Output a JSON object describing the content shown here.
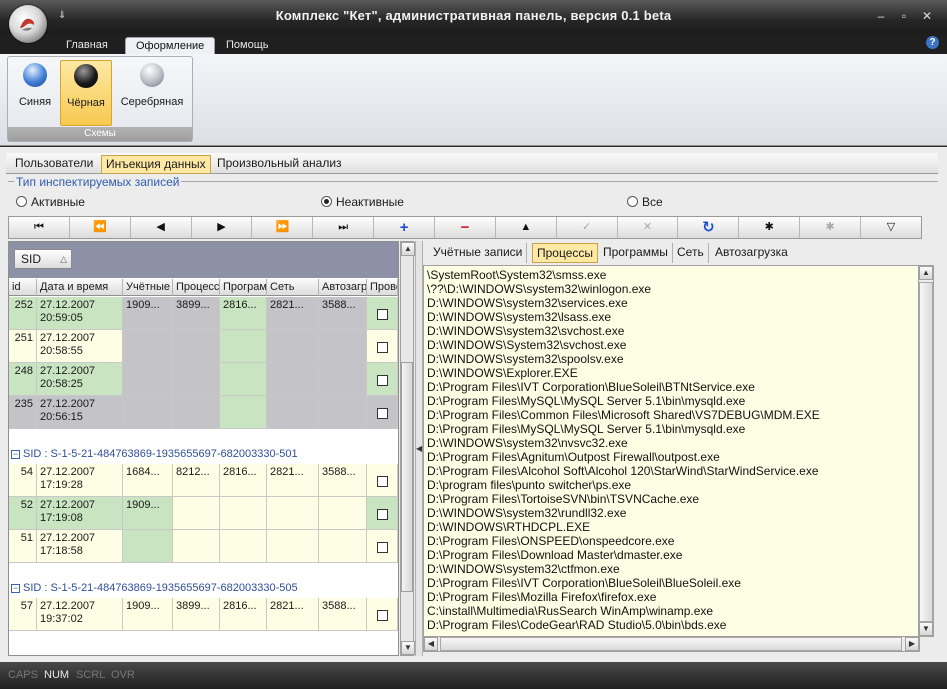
{
  "window": {
    "title": "Комплекс \"Кет\", административная панель, версия 0.1 beta",
    "qat_glyph": "⇓",
    "buttons": {
      "minimize": "–",
      "maximize": "▫",
      "close": "✕"
    }
  },
  "ribbon": {
    "tabs": [
      "Главная",
      "Оформление",
      "Помощь"
    ],
    "active_tab": "Оформление",
    "help_glyph": "?",
    "group_caption": "Схемы",
    "schemes": [
      {
        "label": "Синяя",
        "color": "#3f7fd6",
        "selected": false
      },
      {
        "label": "Чёрная",
        "color": "#111111",
        "selected": true
      },
      {
        "label": "Серебряная",
        "color": "#b9bcc4",
        "selected": false
      }
    ]
  },
  "main_tabs": [
    "Пользователи",
    "Инъекция данных",
    "Произвольный анализ"
  ],
  "active_main_tab": "Инъекция данных",
  "filter": {
    "legend": "Тип инспектируемых записей",
    "options": [
      {
        "label": "Активные",
        "checked": false
      },
      {
        "label": "Неактивные",
        "checked": true
      },
      {
        "label": "Все",
        "checked": false
      }
    ]
  },
  "navigator": [
    {
      "icon": "first-record-icon",
      "glyph": "⏮",
      "style": ""
    },
    {
      "icon": "prior-page-icon",
      "glyph": "⏪",
      "style": ""
    },
    {
      "icon": "prior-record-icon",
      "glyph": "◀",
      "style": ""
    },
    {
      "icon": "next-record-icon",
      "glyph": "▶",
      "style": ""
    },
    {
      "icon": "next-page-icon",
      "glyph": "⏩",
      "style": ""
    },
    {
      "icon": "last-record-icon",
      "glyph": "⏭",
      "style": ""
    },
    {
      "icon": "insert-icon",
      "glyph": "+",
      "style": "blue"
    },
    {
      "icon": "delete-icon",
      "glyph": "−",
      "style": "red"
    },
    {
      "icon": "edit-icon",
      "glyph": "▲",
      "style": ""
    },
    {
      "icon": "post-icon",
      "glyph": "✓",
      "style": "dis"
    },
    {
      "icon": "cancel-icon",
      "glyph": "✕",
      "style": "dis"
    },
    {
      "icon": "refresh-icon",
      "glyph": "↻",
      "style": "blue"
    },
    {
      "icon": "bookmark-icon",
      "glyph": "✱",
      "style": ""
    },
    {
      "icon": "goto-bookmark-icon",
      "glyph": "✱",
      "style": "dis"
    },
    {
      "icon": "filter-icon",
      "glyph": "▽",
      "style": ""
    }
  ],
  "grid": {
    "group_by_chip": "SID",
    "group_by_sort_glyph": "△",
    "columns": [
      "id",
      "Дата и время",
      "Учётные",
      "Процессы",
      "Программы",
      "Сеть",
      "Автозагрузка",
      "Проверено"
    ],
    "groups": [
      {
        "caption": "",
        "rows": [
          {
            "id": "252",
            "date": "27.12.2007",
            "time": "20:59:05",
            "u": "1909...",
            "p": "3899...",
            "g": "2816...",
            "n": "2821...",
            "a": "3588..."
          },
          {
            "id": "251",
            "date": "27.12.2007",
            "time": "20:58:55",
            "u": "",
            "p": "",
            "g": "",
            "n": "",
            "a": ""
          },
          {
            "id": "248",
            "date": "27.12.2007",
            "time": "20:58:25",
            "u": "",
            "p": "",
            "g": "",
            "n": "",
            "a": ""
          },
          {
            "id": "235",
            "date": "27.12.2007",
            "time": "20:56:15",
            "u": "",
            "p": "",
            "g": "",
            "n": "",
            "a": ""
          }
        ]
      },
      {
        "caption": "SID : S-1-5-21-484763869-1935655697-682003330-501",
        "rows": [
          {
            "id": "54",
            "date": "27.12.2007",
            "time": "17:19:28",
            "u": "1684...",
            "p": "8212...",
            "g": "2816...",
            "n": "2821...",
            "a": "3588..."
          },
          {
            "id": "52",
            "date": "27.12.2007",
            "time": "17:19:08",
            "u": "1909...",
            "p": "",
            "g": "",
            "n": "",
            "a": ""
          },
          {
            "id": "51",
            "date": "27.12.2007",
            "time": "17:18:58",
            "u": "",
            "p": "",
            "g": "",
            "n": "",
            "a": ""
          }
        ]
      },
      {
        "caption": "SID : S-1-5-21-484763869-1935655697-682003330-505",
        "rows": [
          {
            "id": "57",
            "date": "27.12.2007",
            "time": "19:37:02",
            "u": "1909...",
            "p": "3899...",
            "g": "2816...",
            "n": "2821...",
            "a": "3588..."
          }
        ]
      }
    ]
  },
  "detail": {
    "tabs": [
      "Учётные записи",
      "Процессы",
      "Программы",
      "Сеть",
      "Автозагрузка"
    ],
    "active_tab": "Процессы",
    "lines": [
      "\\SystemRoot\\System32\\smss.exe",
      "\\??\\D:\\WINDOWS\\system32\\winlogon.exe",
      "D:\\WINDOWS\\system32\\services.exe",
      "D:\\WINDOWS\\system32\\lsass.exe",
      "D:\\WINDOWS\\system32\\svchost.exe",
      "D:\\WINDOWS\\System32\\svchost.exe",
      "D:\\WINDOWS\\system32\\spoolsv.exe",
      "D:\\WINDOWS\\Explorer.EXE",
      "D:\\Program Files\\IVT Corporation\\BlueSoleil\\BTNtService.exe",
      "D:\\Program Files\\MySQL\\MySQL Server 5.1\\bin\\mysqld.exe",
      "D:\\Program Files\\Common Files\\Microsoft Shared\\VS7DEBUG\\MDM.EXE",
      "D:\\Program Files\\MySQL\\MySQL Server 5.1\\bin\\mysqld.exe",
      "D:\\WINDOWS\\system32\\nvsvc32.exe",
      "D:\\Program Files\\Agnitum\\Outpost Firewall\\outpost.exe",
      "D:\\Program Files\\Alcohol Soft\\Alcohol 120\\StarWind\\StarWindService.exe",
      "D:\\program files\\punto switcher\\ps.exe",
      "D:\\Program Files\\TortoiseSVN\\bin\\TSVNCache.exe",
      "D:\\WINDOWS\\system32\\rundll32.exe",
      "D:\\WINDOWS\\RTHDCPL.EXE",
      "D:\\Program Files\\ONSPEED\\onspeedcore.exe",
      "D:\\Program Files\\Download Master\\dmaster.exe",
      "D:\\WINDOWS\\system32\\ctfmon.exe",
      "D:\\Program Files\\IVT Corporation\\BlueSoleil\\BlueSoleil.exe",
      "D:\\Program Files\\Mozilla Firefox\\firefox.exe",
      "C:\\install\\Multimedia\\RusSearch WinAmp\\winamp.exe",
      "D:\\Program Files\\CodeGear\\RAD Studio\\5.0\\bin\\bds.exe"
    ]
  },
  "status_keys": [
    {
      "label": "CAPS",
      "on": false
    },
    {
      "label": "NUM",
      "on": true
    },
    {
      "label": "SCRL",
      "on": false
    },
    {
      "label": "OVR",
      "on": false
    }
  ],
  "colors": {
    "green_cell": "#c8e4c0",
    "yellow_cell": "#fefee4",
    "gray_cell": "#c4c4c8",
    "accent": "#fde9a4"
  }
}
